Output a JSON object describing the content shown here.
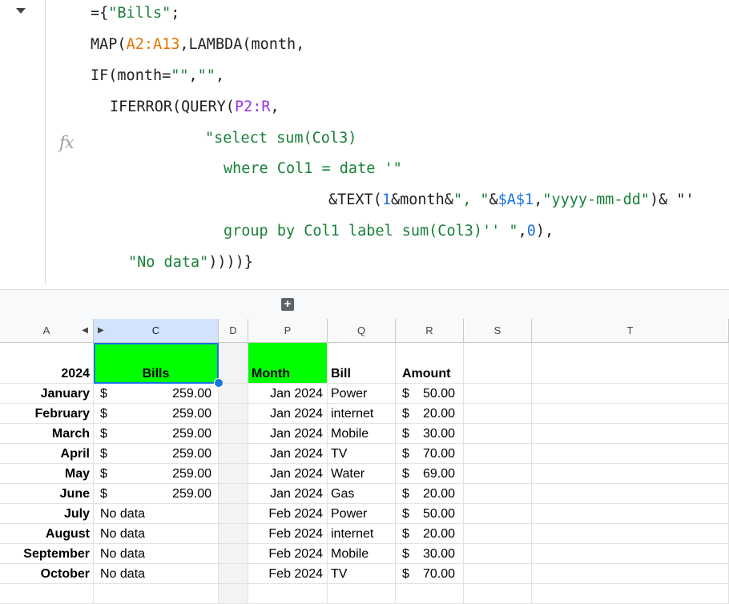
{
  "formula": {
    "lines": [
      [
        "={",
        "\"Bills\"",
        ";"
      ],
      [
        "MAP(",
        "A2:A13",
        ",LAMBDA(month,"
      ],
      [
        "IF(month=",
        "\"\"",
        ",",
        "\"\"",
        ","
      ],
      [
        "IFERROR(QUERY(",
        "P2:R",
        ","
      ],
      [
        "\"select sum(Col3)"
      ],
      [
        "where Col1 = date '\""
      ],
      [
        "&TEXT(",
        "1",
        "&month&",
        "\", \"",
        "&",
        "$A$1",
        ",",
        "\"yyyy-mm-dd\"",
        ")& \"'"
      ],
      [
        "group by Col1 label sum(Col3)'' \"",
        ",",
        "0",
        "),"
      ],
      [
        "\"No data\"",
        "))))}"
      ]
    ],
    "fx_label": "fx"
  },
  "columns": [
    "A",
    "C",
    "D",
    "P",
    "Q",
    "R",
    "S",
    "T"
  ],
  "header_row": {
    "A": "2024",
    "C": "Bills",
    "P": "Month",
    "Q": "Bill",
    "R": "Amount"
  },
  "rows": [
    {
      "month": "January",
      "bills_sym": "$",
      "bills": "259.00",
      "p": "Jan 2024",
      "q": "Power",
      "r": "50.00"
    },
    {
      "month": "February",
      "bills_sym": "$",
      "bills": "259.00",
      "p": "Jan 2024",
      "q": "internet",
      "r": "20.00"
    },
    {
      "month": "March",
      "bills_sym": "$",
      "bills": "259.00",
      "p": "Jan 2024",
      "q": "Mobile",
      "r": "30.00"
    },
    {
      "month": "April",
      "bills_sym": "$",
      "bills": "259.00",
      "p": "Jan 2024",
      "q": "TV",
      "r": "70.00"
    },
    {
      "month": "May",
      "bills_sym": "$",
      "bills": "259.00",
      "p": "Jan 2024",
      "q": "Water",
      "r": "69.00"
    },
    {
      "month": "June",
      "bills_sym": "$",
      "bills": "259.00",
      "p": "Jan 2024",
      "q": "Gas",
      "r": "20.00"
    },
    {
      "month": "July",
      "bills_text": "No data",
      "p": "Feb 2024",
      "q": "Power",
      "r": "50.00"
    },
    {
      "month": "August",
      "bills_text": "No data",
      "p": "Feb 2024",
      "q": "internet",
      "r": "20.00"
    },
    {
      "month": "September",
      "bills_text": "No data",
      "p": "Feb 2024",
      "q": "Mobile",
      "r": "30.00"
    },
    {
      "month": "October",
      "bills_text": "No data",
      "p": "Feb 2024",
      "q": "TV",
      "r": "70.00"
    }
  ],
  "currency_symbol": "$",
  "colors": {
    "highlight": "#00ff00",
    "selection": "#1a73e8"
  }
}
